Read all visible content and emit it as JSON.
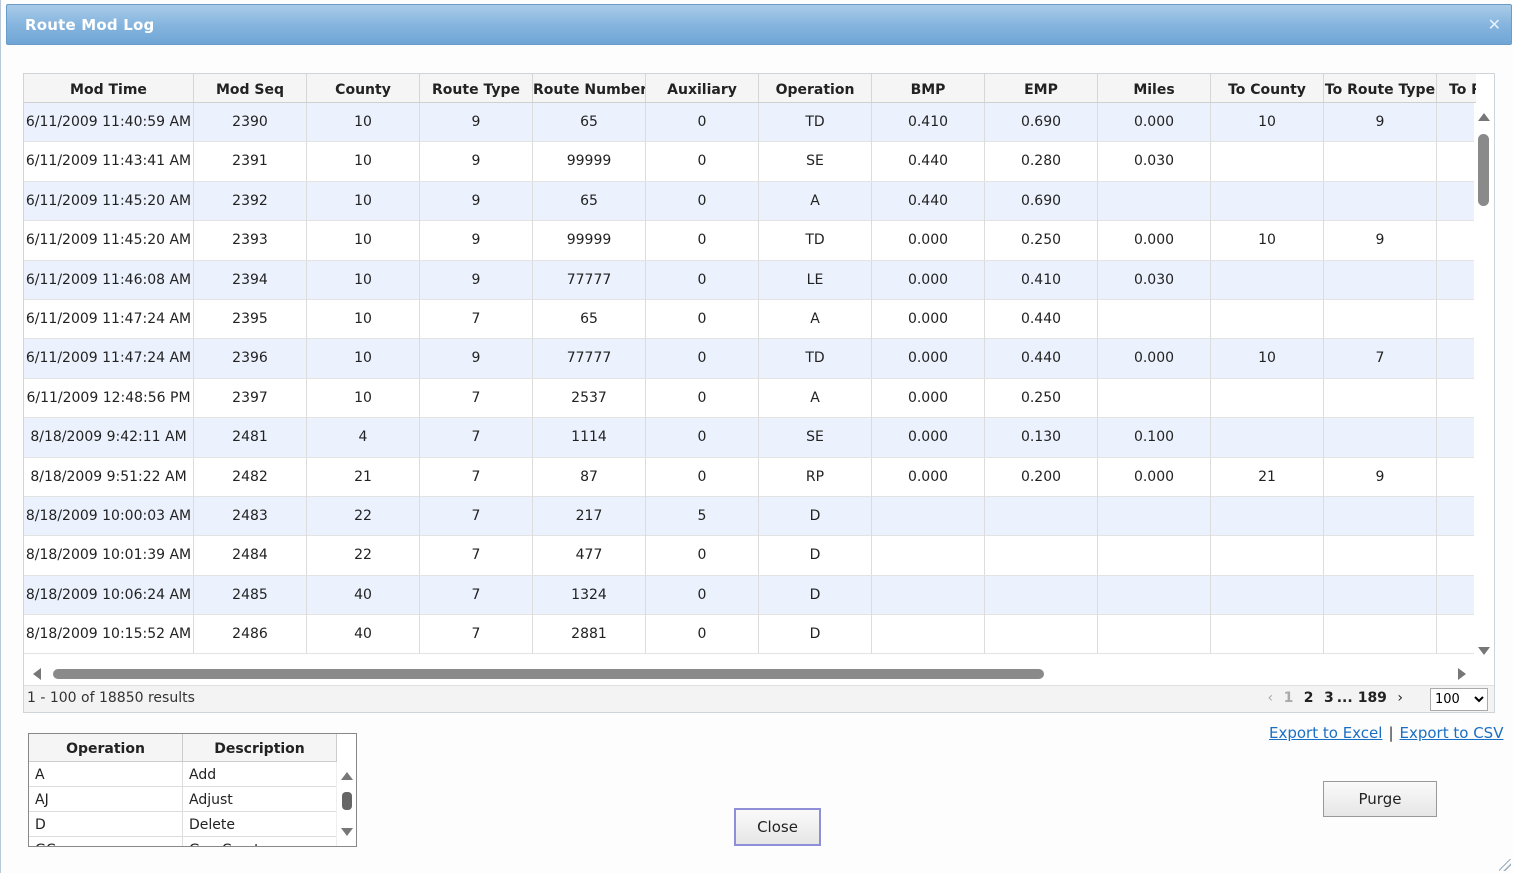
{
  "window": {
    "title": "Route Mod Log"
  },
  "grid": {
    "columns": [
      "Mod Time",
      "Mod Seq",
      "County",
      "Route Type",
      "Route Number",
      "Auxiliary",
      "Operation",
      "BMP",
      "EMP",
      "Miles",
      "To County",
      "To Route Type",
      "To R"
    ],
    "rows": [
      [
        "6/11/2009 11:40:59 AM",
        "2390",
        "10",
        "9",
        "65",
        "0",
        "TD",
        "0.410",
        "0.690",
        "0.000",
        "10",
        "9",
        ""
      ],
      [
        "6/11/2009 11:43:41 AM",
        "2391",
        "10",
        "9",
        "99999",
        "0",
        "SE",
        "0.440",
        "0.280",
        "0.030",
        "",
        "",
        ""
      ],
      [
        "6/11/2009 11:45:20 AM",
        "2392",
        "10",
        "9",
        "65",
        "0",
        "A",
        "0.440",
        "0.690",
        "",
        "",
        "",
        ""
      ],
      [
        "6/11/2009 11:45:20 AM",
        "2393",
        "10",
        "9",
        "99999",
        "0",
        "TD",
        "0.000",
        "0.250",
        "0.000",
        "10",
        "9",
        ""
      ],
      [
        "6/11/2009 11:46:08 AM",
        "2394",
        "10",
        "9",
        "77777",
        "0",
        "LE",
        "0.000",
        "0.410",
        "0.030",
        "",
        "",
        ""
      ],
      [
        "6/11/2009 11:47:24 AM",
        "2395",
        "10",
        "7",
        "65",
        "0",
        "A",
        "0.000",
        "0.440",
        "",
        "",
        "",
        ""
      ],
      [
        "6/11/2009 11:47:24 AM",
        "2396",
        "10",
        "9",
        "77777",
        "0",
        "TD",
        "0.000",
        "0.440",
        "0.000",
        "10",
        "7",
        ""
      ],
      [
        "6/11/2009 12:48:56 PM",
        "2397",
        "10",
        "7",
        "2537",
        "0",
        "A",
        "0.000",
        "0.250",
        "",
        "",
        "",
        ""
      ],
      [
        "8/18/2009 9:42:11 AM",
        "2481",
        "4",
        "7",
        "1114",
        "0",
        "SE",
        "0.000",
        "0.130",
        "0.100",
        "",
        "",
        ""
      ],
      [
        "8/18/2009 9:51:22 AM",
        "2482",
        "21",
        "7",
        "87",
        "0",
        "RP",
        "0.000",
        "0.200",
        "0.000",
        "21",
        "9",
        ""
      ],
      [
        "8/18/2009 10:00:03 AM",
        "2483",
        "22",
        "7",
        "217",
        "5",
        "D",
        "",
        "",
        "",
        "",
        "",
        ""
      ],
      [
        "8/18/2009 10:01:39 AM",
        "2484",
        "22",
        "7",
        "477",
        "0",
        "D",
        "",
        "",
        "",
        "",
        "",
        ""
      ],
      [
        "8/18/2009 10:06:24 AM",
        "2485",
        "40",
        "7",
        "1324",
        "0",
        "D",
        "",
        "",
        "",
        "",
        "",
        ""
      ],
      [
        "8/18/2009 10:15:52 AM",
        "2486",
        "40",
        "7",
        "2881",
        "0",
        "D",
        "",
        "",
        "",
        "",
        "",
        ""
      ]
    ]
  },
  "pager": {
    "info": "1 - 100 of 18850 results",
    "prev": "‹",
    "current": "1",
    "pages": [
      "2",
      "3"
    ],
    "ellipsis": "...",
    "last": "189",
    "next": "›",
    "page_size": "100"
  },
  "export": {
    "excel": "Export to Excel",
    "separator": "|",
    "csv": "Export to CSV"
  },
  "legend": {
    "columns": [
      "Operation",
      "Description"
    ],
    "rows": [
      [
        "A",
        "Add"
      ],
      [
        "AJ",
        "Adjust"
      ],
      [
        "D",
        "Delete"
      ],
      [
        "GC",
        "Gap Create"
      ]
    ]
  },
  "buttons": {
    "close": "Close",
    "purge": "Purge"
  },
  "icons": {
    "close": "close-icon",
    "scroll_up": "chevron-up-icon",
    "scroll_down": "chevron-down-icon",
    "scroll_left": "chevron-left-icon",
    "scroll_right": "chevron-right-icon",
    "resize": "resize-grip-icon"
  }
}
